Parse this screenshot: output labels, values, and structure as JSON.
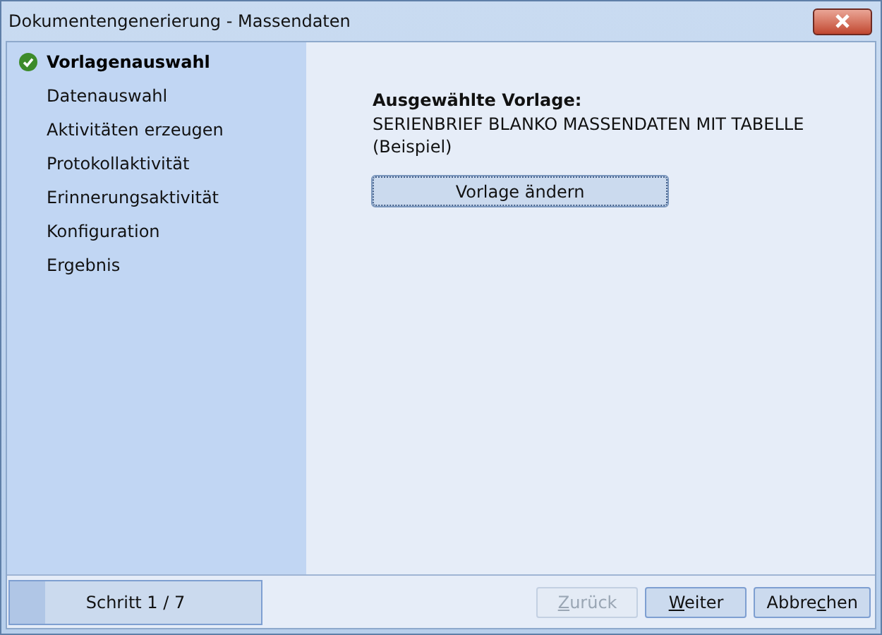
{
  "window": {
    "title": "Dokumentengenerierung - Massendaten"
  },
  "steps": [
    {
      "label": "Vorlagenauswahl",
      "selected": true,
      "done": true
    },
    {
      "label": "Datenauswahl",
      "selected": false,
      "done": false
    },
    {
      "label": "Aktivitäten erzeugen",
      "selected": false,
      "done": false
    },
    {
      "label": "Protokollaktivität",
      "selected": false,
      "done": false
    },
    {
      "label": "Erinnerungsaktivität",
      "selected": false,
      "done": false
    },
    {
      "label": "Konfiguration",
      "selected": false,
      "done": false
    },
    {
      "label": "Ergebnis",
      "selected": false,
      "done": false
    }
  ],
  "content": {
    "heading": "Ausgewählte Vorlage:",
    "template_name": "SERIENBRIEF BLANKO MASSENDATEN MIT TABELLE",
    "template_note": "(Beispiel)",
    "change_button": "Vorlage ändern"
  },
  "progress": {
    "text": "Schritt 1 / 7",
    "level": 0.143
  },
  "buttons": [
    {
      "access_key": "Z",
      "label_after": "urück",
      "disabled": true
    },
    {
      "access_key": "W",
      "label_after": "eiter",
      "disabled": false
    },
    {
      "label_before": "Abbre",
      "access_key": "c",
      "label_after": "hen",
      "disabled": false
    }
  ]
}
